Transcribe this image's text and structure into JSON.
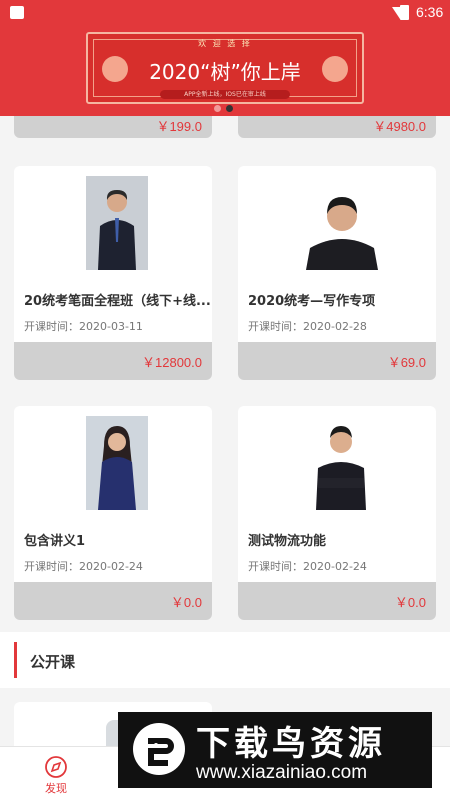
{
  "status_bar": {
    "time": "6:36"
  },
  "banner": {
    "top_tag": "欢 迎 选 择",
    "title": "2020“树”你上岸",
    "subtitle": "APP全新上线，IOS已在审上线"
  },
  "top_cards": [
    {
      "price": "￥199.0"
    },
    {
      "price": "￥4980.0"
    }
  ],
  "courses": [
    {
      "title": "20统考笔面全程班（线下+线...",
      "date_label": "开课时间：2020-03-11",
      "price": "￥12800.0"
    },
    {
      "title": "2020统考—写作专项",
      "date_label": "开课时间：2020-02-28",
      "price": "￥69.0"
    },
    {
      "title": "包含讲义1",
      "date_label": "开课时间：2020-02-24",
      "price": "￥0.0"
    },
    {
      "title": "测试物流功能",
      "date_label": "开课时间：2020-02-24",
      "price": "￥0.0"
    }
  ],
  "section": {
    "title": "公开课"
  },
  "tabs": [
    {
      "label": "发现",
      "icon": "discover-icon"
    },
    {
      "label": "",
      "icon": "course-icon"
    },
    {
      "label": "",
      "icon": "book-icon"
    },
    {
      "label": "",
      "icon": "profile-icon"
    }
  ],
  "watermark": {
    "title": "下载鸟资源",
    "url": "www.xiazainiao.com"
  },
  "colors": {
    "accent": "#e2383b",
    "price_bar": "#d0d0d0",
    "page_bg": "#f4f4f4"
  }
}
